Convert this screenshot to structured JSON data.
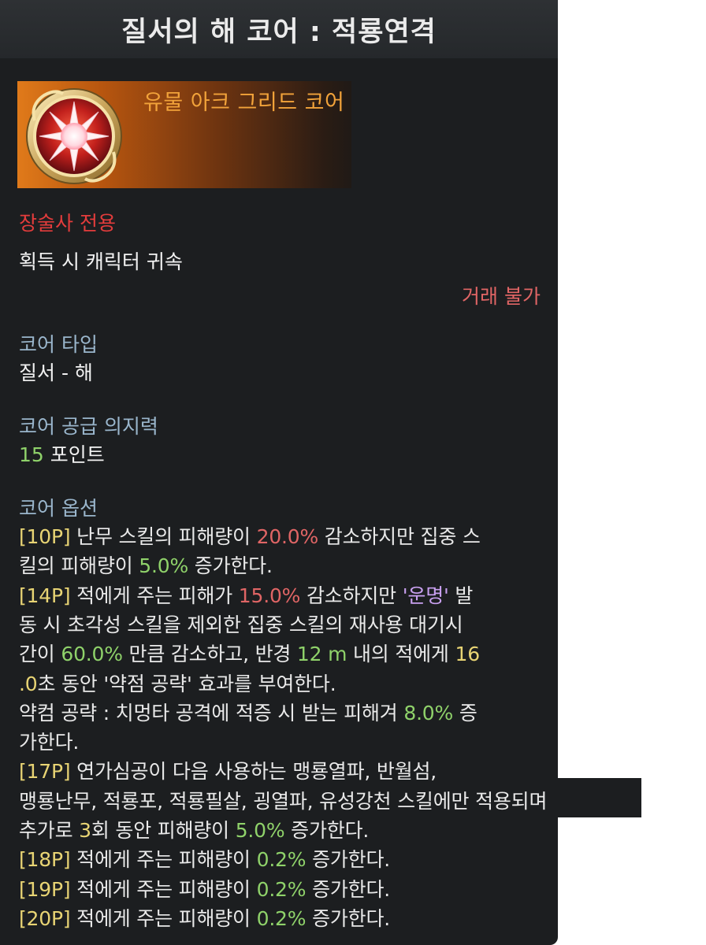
{
  "title": "질서의 해 코어 : 적룡연격",
  "item": {
    "icon": "sun-emblem-icon",
    "name": "유물 아크 그리드 코어"
  },
  "restriction": "장술사 전용",
  "bind": "획득 시 캐릭터 귀속",
  "trade": "거래 불가",
  "core_type": {
    "label": "코어 타입",
    "value": "질서 - 해"
  },
  "willpower": {
    "label": "코어 공급 의지력",
    "value": "15",
    "unit": " 포인트"
  },
  "options": {
    "label": "코어 옵션",
    "lines": [
      [
        {
          "t": "[10P]",
          "c": "yellow"
        },
        {
          "t": " 난무 스킬의 피해량이 ",
          "c": "grey"
        },
        {
          "t": "20.0%",
          "c": "warn"
        },
        {
          "t": " 감소하지만 집중 스",
          "c": "grey"
        }
      ],
      [
        {
          "t": "킬의 피해량이 ",
          "c": "grey"
        },
        {
          "t": "5.0%",
          "c": "green"
        },
        {
          "t": " 증가한다.",
          "c": "grey"
        }
      ],
      [
        {
          "t": "[14P]",
          "c": "yellow"
        },
        {
          "t": " 적에게 주는 피해가 ",
          "c": "grey"
        },
        {
          "t": "15.0%",
          "c": "warn"
        },
        {
          "t": " 감소하지만 ",
          "c": "grey"
        },
        {
          "t": "'운명'",
          "c": "destiny"
        },
        {
          "t": " 발",
          "c": "grey"
        }
      ],
      [
        {
          "t": "동 시 초각성 스킬을 제외한 집중 스킬의 재사용 대기시",
          "c": "grey"
        }
      ],
      [
        {
          "t": "간이 ",
          "c": "grey"
        },
        {
          "t": "60.0%",
          "c": "green"
        },
        {
          "t": " 만큼 감소하고, 반경 ",
          "c": "grey"
        },
        {
          "t": "12 m",
          "c": "green"
        },
        {
          "t": " 내의 적에게 ",
          "c": "grey"
        },
        {
          "t": "16",
          "c": "yellow"
        }
      ],
      [
        {
          "t": ".0",
          "c": "yellow"
        },
        {
          "t": "초 동안 '약점 공략' 효과를 부여한다.",
          "c": "grey"
        }
      ],
      [
        {
          "t": "약컴 공략 : 치멍타 공격에 적증 시 받는 피해겨 ",
          "c": "grey"
        },
        {
          "t": "8.0%",
          "c": "green"
        },
        {
          "t": " 증",
          "c": "grey"
        }
      ],
      [
        {
          "t": "가한다.",
          "c": "grey"
        }
      ],
      [
        {
          "t": "[17P]",
          "c": "yellow"
        },
        {
          "t": " 연가심공이 다음 사용하는 맹룡열파, 반월섬,",
          "c": "grey"
        }
      ],
      [
        {
          "t": "맹룡난무, 적룡포, 적룡필살, 굉열파, 유성강천 스킬에만 적용되며",
          "c": "grey"
        }
      ],
      [
        {
          "t": "추가로 ",
          "c": "grey"
        },
        {
          "t": "3",
          "c": "yellow"
        },
        {
          "t": "회 동안 피해량이 ",
          "c": "grey"
        },
        {
          "t": "5.0%",
          "c": "green"
        },
        {
          "t": " 증가한다.",
          "c": "grey"
        }
      ],
      [
        {
          "t": "[18P]",
          "c": "yellow"
        },
        {
          "t": " 적에게 주는 피해량이 ",
          "c": "grey"
        },
        {
          "t": "0.2%",
          "c": "green"
        },
        {
          "t": " 증가한다.",
          "c": "grey"
        }
      ],
      [
        {
          "t": "[19P]",
          "c": "yellow"
        },
        {
          "t": " 적에게 주는 피해량이 ",
          "c": "grey"
        },
        {
          "t": "0.2%",
          "c": "green"
        },
        {
          "t": " 증가한다.",
          "c": "grey"
        }
      ],
      [
        {
          "t": "[20P]",
          "c": "yellow"
        },
        {
          "t": " 적에게 주는 피해량이 ",
          "c": "grey"
        },
        {
          "t": "0.2%",
          "c": "green"
        },
        {
          "t": " 증가한다.",
          "c": "grey"
        }
      ]
    ]
  },
  "colors": {
    "background": "#1c1e20",
    "title_text": "#ebebeb",
    "item_name": "#f2a33a",
    "restriction": "#e33c3c",
    "label": "#9ab6cc",
    "option_point": "#e8d474",
    "increase": "#8fd26a",
    "decrease": "#e06565",
    "destiny": "#c9a0f0"
  }
}
